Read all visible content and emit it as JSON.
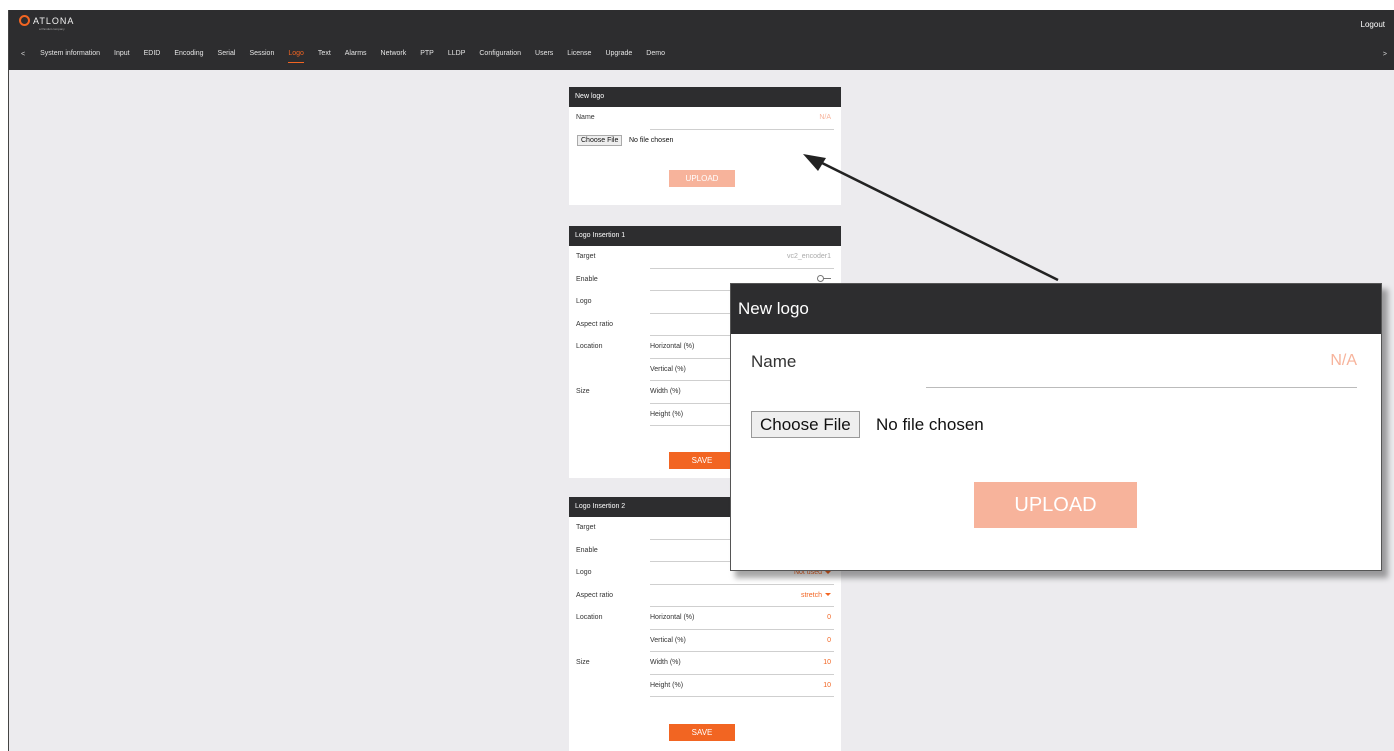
{
  "header": {
    "brand": "ATLONA",
    "brand_sub": "a Panduit company",
    "logout": "Logout"
  },
  "nav": {
    "left_arrow": "<",
    "right_arrow": ">",
    "tabs": [
      "System information",
      "Input",
      "EDID",
      "Encoding",
      "Serial",
      "Session",
      "Logo",
      "Text",
      "Alarms",
      "Network",
      "PTP",
      "LLDP",
      "Configuration",
      "Users",
      "License",
      "Upgrade",
      "Demo"
    ],
    "active": "Logo"
  },
  "new_logo": {
    "title": "New logo",
    "name_label": "Name",
    "name_value": "N/A",
    "choose_file": "Choose File",
    "no_file": "No file chosen",
    "upload": "UPLOAD"
  },
  "insertion1": {
    "title": "Logo Insertion 1",
    "target_label": "Target",
    "target_value": "vc2_encoder1",
    "enable_label": "Enable",
    "logo_label": "Logo",
    "aspect_label": "Aspect ratio",
    "location_label": "Location",
    "horizontal_label": "Horizontal (%)",
    "vertical_label": "Vertical (%)",
    "size_label": "Size",
    "width_label": "Width (%)",
    "height_label": "Height (%)",
    "save": "SAVE"
  },
  "insertion2": {
    "title": "Logo Insertion 2",
    "target_label": "Target",
    "enable_label": "Enable",
    "logo_label": "Logo",
    "logo_value": "Not used",
    "aspect_label": "Aspect ratio",
    "aspect_value": "stretch",
    "location_label": "Location",
    "horizontal_label": "Horizontal (%)",
    "horizontal_value": "0",
    "vertical_label": "Vertical (%)",
    "vertical_value": "0",
    "size_label": "Size",
    "width_label": "Width (%)",
    "width_value": "10",
    "height_label": "Height (%)",
    "height_value": "10",
    "save": "SAVE"
  },
  "zoom": {
    "title": "New logo",
    "name_label": "Name",
    "name_value": "N/A",
    "choose_file": "Choose File",
    "no_file": "No file chosen",
    "upload": "UPLOAD"
  },
  "colors": {
    "accent": "#f26522",
    "accent_faded": "#f7b39b",
    "header_bg": "#2d2d2f",
    "page_bg": "#ecebee"
  }
}
